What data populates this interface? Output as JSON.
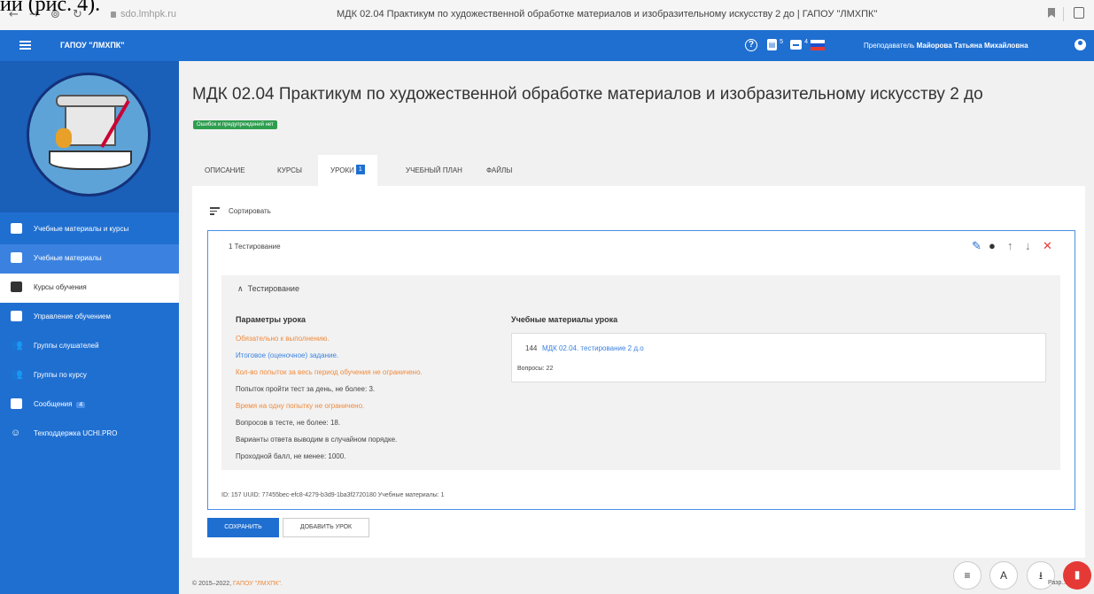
{
  "doc_overlay_text": "ии (рис. 4).",
  "browser": {
    "url": "sdo.lmhpk.ru",
    "title": "МДК 02.04 Практикум по художественной обработке материалов и изобразительному искусству 2 до | ГАПОУ \"ЛМХПК\""
  },
  "header": {
    "brand": "ГАПОУ \"ЛМХПК\"",
    "doc_count": "5",
    "msg_count": "4",
    "role": "Преподаватель",
    "user_name": "Майорова Татьяна Михайловна"
  },
  "sidebar": {
    "items": [
      {
        "label": "Учебные материалы и курсы"
      },
      {
        "label": "Учебные материалы"
      },
      {
        "label": "Курсы обучения"
      },
      {
        "label": "Управление обучением"
      },
      {
        "label": "Группы слушателей"
      },
      {
        "label": "Группы по курсу"
      },
      {
        "label": "Сообщения",
        "badge": "4"
      },
      {
        "label": "Техподдержка UCHI.PRO"
      }
    ]
  },
  "main": {
    "title": "МДК 02.04 Практикум по художественной обработке материалов и изобразительному искусству 2 до",
    "status": "Ошибок и предупреждений нет",
    "tabs": [
      {
        "label": "ОПИСАНИЕ"
      },
      {
        "label": "КУРСЫ"
      },
      {
        "label": "УРОКИ",
        "badge": "1"
      },
      {
        "label": "УЧЕБНЫЙ ПЛАН"
      },
      {
        "label": "ФАЙЛЫ"
      }
    ],
    "sort_label": "Сортировать",
    "lesson": {
      "header": "1  Тестирование",
      "section": "Тестирование",
      "params_title": "Параметры урока",
      "params": [
        {
          "text": "Обязательно к выполнению.",
          "color": "#f08a3c"
        },
        {
          "text": "Итоговое (оценочное) задание.",
          "color": "#3b82e0"
        },
        {
          "text": "Кол-во попыток за весь период обучения не ограничено.",
          "color": "#f08a3c"
        },
        {
          "text": "Попыток пройти тест за день, не более: 3.",
          "color": "#444444"
        },
        {
          "text": "Время на одну попытку не ограничено.",
          "color": "#f08a3c"
        },
        {
          "text": "Вопросов в тесте, не более: 18.",
          "color": "#444444"
        },
        {
          "text": "Варианты ответа выводим в случайном порядке.",
          "color": "#444444"
        },
        {
          "text": "Проходной балл, не менее: 1000.",
          "color": "#444444"
        }
      ],
      "materials_title": "Учебные материалы урока",
      "material_id": "144",
      "material_link": "МДК 02.04. тестирование 2 д.о",
      "material_questions": "Вопросы: 22",
      "meta": "ID: 157   UUID: 77455bec-efc8-4279-b3d9-1ba3f2720180   Учебные материалы: 1"
    },
    "save_label": "СОХРАНИТЬ",
    "add_label": "ДОБАВИТЬ УРОК"
  },
  "footer": {
    "copyright": "© 2015–2022,",
    "org": "ГАПОУ \"ЛМХПК\".",
    "partial": "Разр... Учи"
  },
  "colors": {
    "primary": "#1f6fd1",
    "success": "#2e9e4f",
    "warning": "#f08a3c",
    "danger": "#e53935"
  }
}
